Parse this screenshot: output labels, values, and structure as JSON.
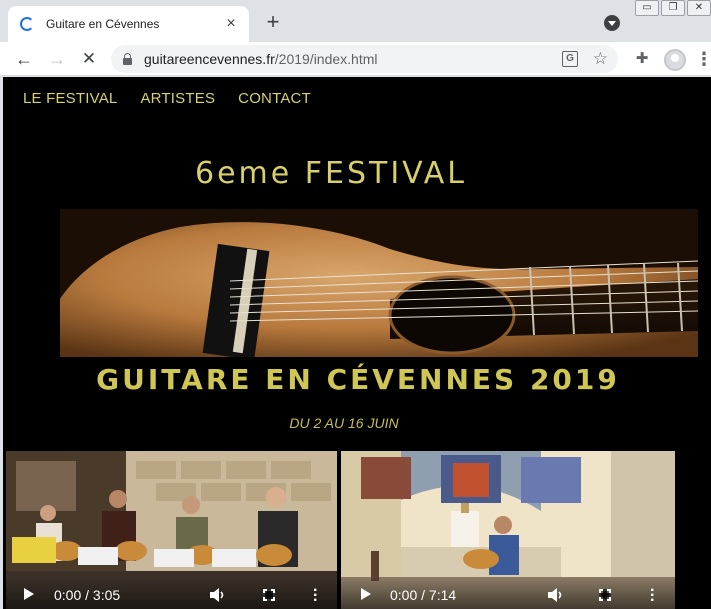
{
  "browser": {
    "tab_title": "Guitare en Cévennes",
    "new_tab_label": "+",
    "close_label": "×",
    "url_domain": "guitareencevennes.fr",
    "url_path": "/2019/index.html",
    "icons": [
      "loading-spinner-icon",
      "close-icon",
      "plus-icon",
      "tab-search-icon",
      "back-arrow-icon",
      "forward-arrow-icon",
      "stop-icon",
      "lock-icon",
      "translate-icon",
      "star-icon",
      "extensions-icon",
      "profile-icon",
      "more-vert-icon"
    ]
  },
  "site": {
    "nav": [
      {
        "label": "LE FESTIVAL"
      },
      {
        "label": "ARTISTES"
      },
      {
        "label": "CONTACT"
      }
    ],
    "festival_line": "6eme FESTIVAL",
    "title": "GUITARE EN CÉVENNES 2019",
    "dates": "DU 2 AU 16 JUIN",
    "accent_color": "#d6cf6a"
  },
  "videos": [
    {
      "time": "0:00 / 3:05"
    },
    {
      "time": "0:00 / 7:14"
    }
  ]
}
